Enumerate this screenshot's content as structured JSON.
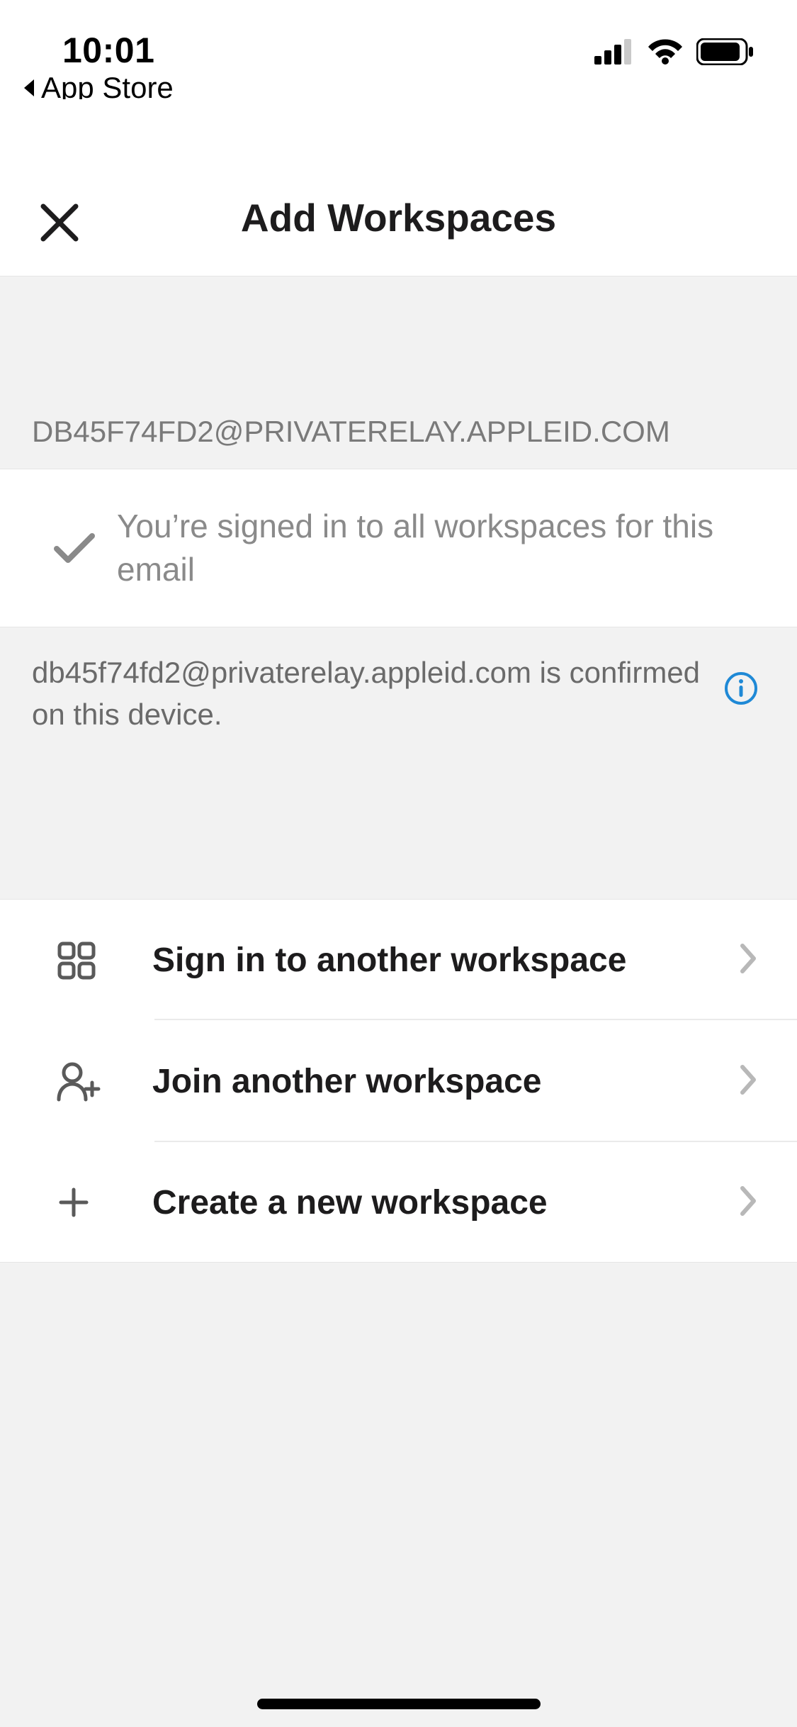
{
  "status_bar": {
    "time": "10:01",
    "back_app_label": "App Store"
  },
  "header": {
    "title": "Add Workspaces"
  },
  "email_section": {
    "header": "DB45F74FD2@PRIVATERELAY.APPLEID.COM",
    "signed_in_message": "You’re signed in to all workspaces for this email",
    "footer_note": "db45f74fd2@privaterelay.appleid.com is confirmed on this device."
  },
  "actions": {
    "sign_in_label": "Sign in to another workspace",
    "join_label": "Join another workspace",
    "create_label": "Create a new workspace"
  }
}
